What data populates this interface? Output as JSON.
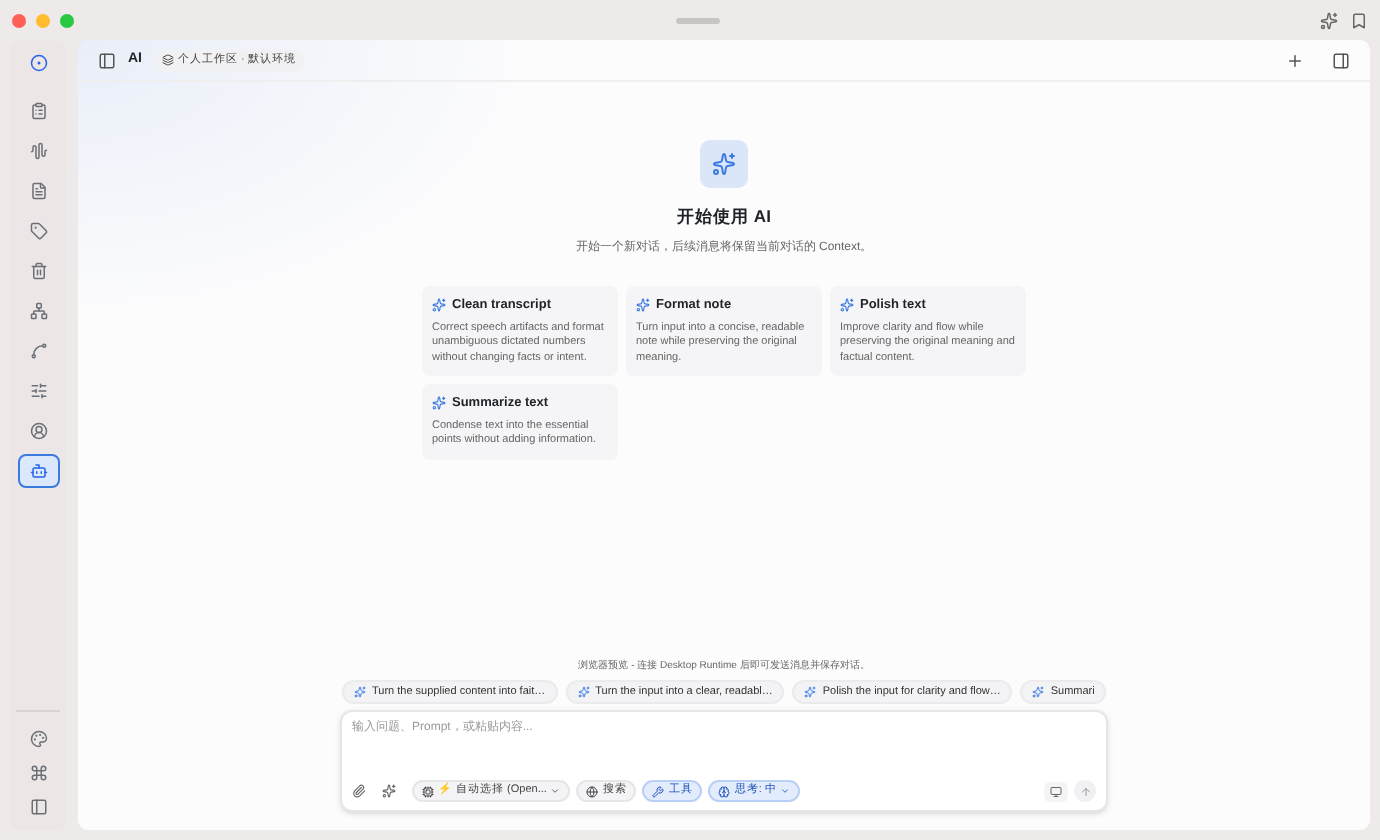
{
  "header": {
    "title": "AI",
    "workspace": "个人工作区 · 默认环境"
  },
  "sidebar_items": [
    {
      "selected": false
    },
    {
      "selected": false
    },
    {
      "selected": false
    },
    {
      "selected": false
    },
    {
      "selected": false
    },
    {
      "selected": false
    },
    {
      "selected": false
    },
    {
      "selected": false
    },
    {
      "selected": false
    },
    {
      "selected": false
    },
    {
      "selected": true
    }
  ],
  "hero": {
    "title": "开始使用 AI",
    "subtitle": "开始一个新对话，后续消息将保留当前对话的 Context。"
  },
  "cards": [
    {
      "title": "Clean transcript",
      "description": "Correct speech artifacts and format unambiguous dictated numbers without changing facts or intent."
    },
    {
      "title": "Format note",
      "description": "Turn input into a concise, readable note while preserving the original meaning."
    },
    {
      "title": "Polish text",
      "description": "Improve clarity and flow while preserving the original meaning and factual content."
    },
    {
      "title": "Summarize text",
      "description": "Condense text into the essential points without adding information."
    }
  ],
  "notice": "浏览器预览 - 连接 Desktop Runtime 后即可发送消息并保存对话。",
  "suggestions": [
    "Turn the supplied content into fait…",
    "Turn the input into a clear, readabl…",
    "Polish the input for clarity and flow…",
    "Summari"
  ],
  "composer": {
    "placeholder": "输入问题、Prompt，或粘贴内容...",
    "controls": [
      {
        "kind": "dropdown",
        "icon": "⚡",
        "label": "自动选择 (Open...",
        "active": false
      },
      {
        "kind": "toggle",
        "label": "搜索",
        "active": false
      },
      {
        "kind": "toggle",
        "label": "工具",
        "active": true
      },
      {
        "kind": "dropdown",
        "label": "思考: 中",
        "active": true
      }
    ]
  }
}
